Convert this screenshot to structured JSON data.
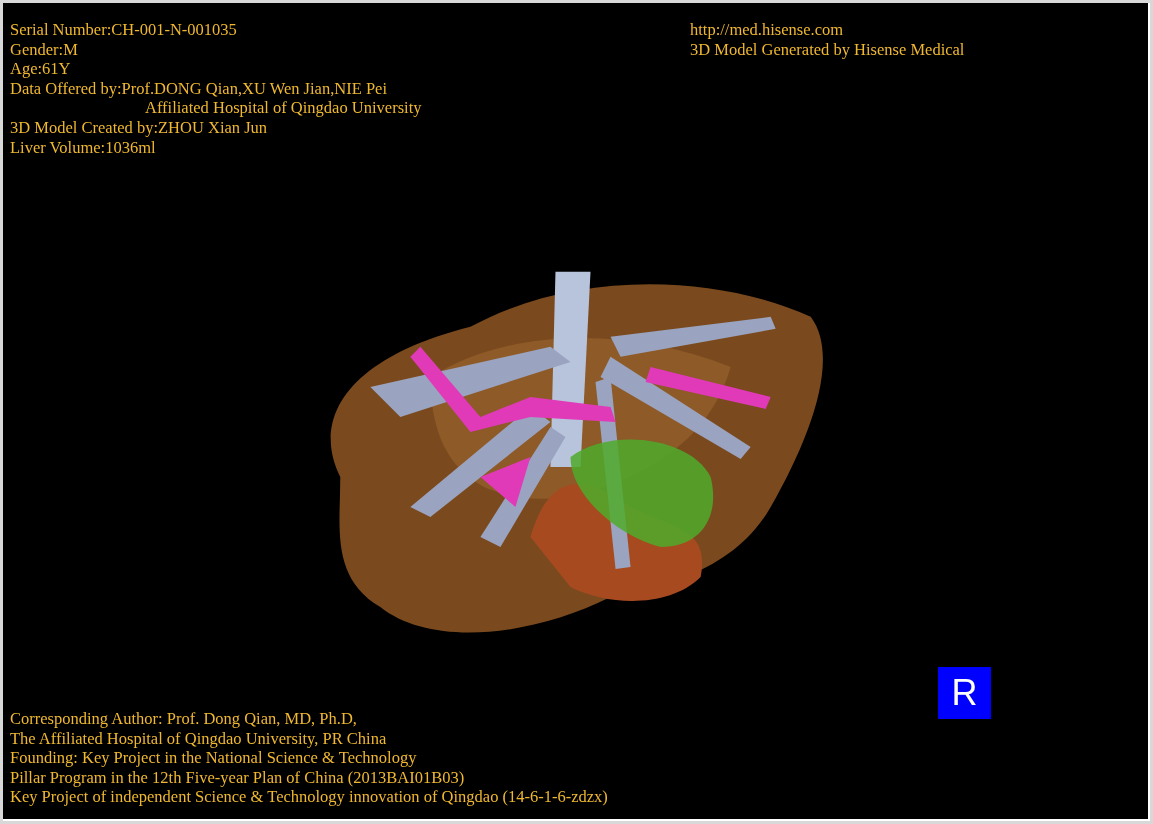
{
  "header_left": [
    {
      "kind": "plain",
      "text": "Serial Number:CH-001-N-001035"
    },
    {
      "kind": "plain",
      "text": "Gender:M"
    },
    {
      "kind": "plain",
      "text": "Age:61Y"
    },
    {
      "kind": "plain",
      "text": "Data Offered by:Prof.DONG Qian,XU Wen Jian,NIE Pei"
    },
    {
      "kind": "indented",
      "text": "Affiliated Hospital of Qingdao University"
    },
    {
      "kind": "plain",
      "text": "3D Model Created by:ZHOU Xian Jun"
    },
    {
      "kind": "plain",
      "text": "Liver Volume:1036ml"
    }
  ],
  "header_right": [
    {
      "kind": "plain",
      "text": "http://med.hisense.com"
    },
    {
      "kind": "plain",
      "text": "3D Model Generated by Hisense Medical"
    }
  ],
  "footer": [
    {
      "kind": "plain",
      "text": "Corresponding Author: Prof. Dong Qian, MD, Ph.D,"
    },
    {
      "kind": "plain",
      "text": "The Affiliated Hospital of Qingdao University, PR China"
    },
    {
      "kind": "plain",
      "text": "Founding: Key Project in the National Science & Technology"
    },
    {
      "kind": "plain",
      "text": "Pillar Program in the 12th Five-year Plan of China (2013BAI01B03)"
    },
    {
      "kind": "plain",
      "text": "Key Project of independent Science & Technology innovation of Qingdao (14-6-1-6-zdzx)"
    }
  ],
  "orientation_marker": {
    "text": "R"
  }
}
